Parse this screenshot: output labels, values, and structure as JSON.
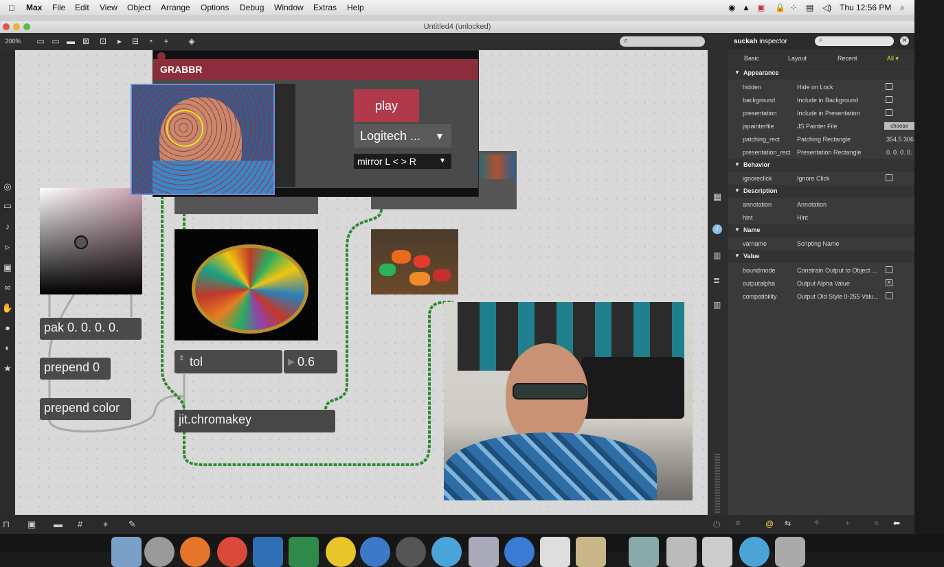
{
  "menubar": {
    "apple": "",
    "app": "Max",
    "items": [
      "File",
      "Edit",
      "View",
      "Object",
      "Arrange",
      "Options",
      "Debug",
      "Window",
      "Extras",
      "Help"
    ],
    "clock": "Thu 12:56 PM"
  },
  "window": {
    "title": "Untitled4 (unlocked)"
  },
  "toolbar": {
    "zoom": "200%"
  },
  "grabbr": {
    "title": "GRABBR",
    "play_label": "play",
    "device_label": "Logitech ...",
    "mirror_label": "mirror L < > R"
  },
  "objects": {
    "pak": "pak 0. 0. 0. 0.",
    "prepend0": "prepend 0",
    "prepend_color": "prepend color",
    "tol_label": "tol",
    "tol_value": "0.6",
    "chromakey": "jit.chromakey"
  },
  "inspector": {
    "title_bold": "suckah",
    "title_rest": " inspector",
    "tabs": [
      "Basic",
      "Layout",
      "Recent",
      "All ▾"
    ],
    "sections": {
      "appearance": "Appearance",
      "behavior": "Behavior",
      "description": "Description",
      "name": "Name",
      "value": "Value"
    },
    "rows": {
      "hidden": {
        "prop": "hidden",
        "desc": "Hide on Lock"
      },
      "background": {
        "prop": "background",
        "desc": "Include in Background"
      },
      "presentation": {
        "prop": "presentation",
        "desc": "Include in Presentation"
      },
      "jspainterfile": {
        "prop": "jspainterfile",
        "desc": "JS Painter File",
        "value": "choose"
      },
      "patching_rect": {
        "prop": "patching_rect",
        "desc": "Patching Rectangle",
        "value": "354.5 306"
      },
      "presentation_rect": {
        "prop": "presentation_rect",
        "desc": "Presentation Rectangle",
        "value": "0. 0. 0. 0."
      },
      "ignoreclick": {
        "prop": "ignoreclick",
        "desc": "Ignore Click"
      },
      "annotation": {
        "prop": "annotation",
        "desc": "Annotation"
      },
      "hint": {
        "prop": "hint",
        "desc": "Hint"
      },
      "varname": {
        "prop": "varname",
        "desc": "Scripting Name"
      },
      "boundmode": {
        "prop": "boundmode",
        "desc": "Constrain Output to Object ..."
      },
      "outputalpha": {
        "prop": "outputalpha",
        "desc": "Output Alpha Value"
      },
      "compatibility": {
        "prop": "compatibility",
        "desc": "Output Old Style 0-255 Valu..."
      }
    }
  },
  "colors": {
    "accent_green": "#9fd64a",
    "patch_cord": "#3a9a3a",
    "grabbr_red": "#8c2d3c"
  }
}
